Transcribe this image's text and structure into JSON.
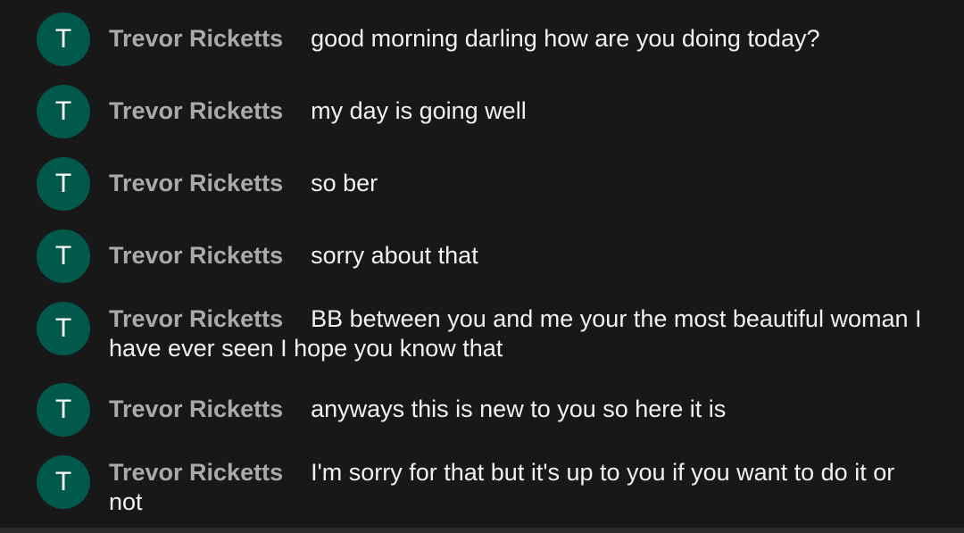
{
  "messages": [
    {
      "avatar_letter": "T",
      "author": "Trevor Ricketts",
      "text": "good morning darling how are you doing today?"
    },
    {
      "avatar_letter": "T",
      "author": "Trevor Ricketts",
      "text": "my day is going well"
    },
    {
      "avatar_letter": "T",
      "author": "Trevor Ricketts",
      "text": "so ber"
    },
    {
      "avatar_letter": "T",
      "author": "Trevor Ricketts",
      "text": "sorry about that"
    },
    {
      "avatar_letter": "T",
      "author": "Trevor Ricketts",
      "text": "BB between you and me your the most beautiful woman I have ever seen I hope you know that"
    },
    {
      "avatar_letter": "T",
      "author": "Trevor Ricketts",
      "text": "anyways this is new to you so here it is"
    },
    {
      "avatar_letter": "T",
      "author": "Trevor Ricketts",
      "text": "I'm sorry for that but it's up to you if you want to do it or not"
    }
  ],
  "colors": {
    "background": "#181818",
    "avatar": "#00594a",
    "author": "#aaaaaa",
    "text": "#f1f1f1"
  }
}
